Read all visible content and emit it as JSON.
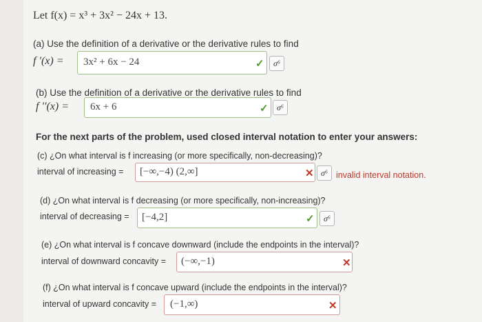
{
  "problem": {
    "statement": "Let f(x) = x³ + 3x² − 24x + 13."
  },
  "part_a": {
    "prompt": "(a)  Use the definition of a derivative or the derivative rules to find",
    "label": "f ′(x) =",
    "answer": "3x² + 6x − 24",
    "status": "correct",
    "check_icon": "check-icon",
    "symbol_button_label": "σ⁶"
  },
  "part_b": {
    "prompt": "(b)  Use the definition of a derivative or the derivative rules to find",
    "label": "f ′′(x) =",
    "answer": "6x + 6",
    "status": "correct",
    "symbol_button_label": "σ⁶"
  },
  "instructions": "For the next parts of the problem, used closed interval notation to enter your answers:",
  "part_c": {
    "prompt": "(c)  ¿On what interval is f increasing (or more specifically, non-decreasing)?",
    "label": "interval of increasing =",
    "answer": "[−∞,−4) (2,∞]",
    "status": "incorrect",
    "feedback": "invalid interval notation.",
    "symbol_button_label": "σ⁶"
  },
  "part_d": {
    "prompt": "(d)  ¿On what interval is f decreasing (or more specifically, non-increasing)?",
    "label": "interval of decreasing =",
    "answer": "[−4,2]",
    "status": "correct",
    "symbol_button_label": "σ⁶"
  },
  "part_e": {
    "prompt": "(e)  ¿On what interval is f concave downward (include the endpoints in the interval)?",
    "label": "interval of downward concavity =",
    "answer": "(−∞,−1)",
    "status": "incorrect"
  },
  "part_f": {
    "prompt": "(f)  ¿On what interval is f concave upward (include the endpoints in the interval)?",
    "label": "interval of upward concavity =",
    "answer": "(−1,∞)",
    "status": "incorrect"
  },
  "colors": {
    "correct": "#4f9a2a",
    "incorrect": "#c0392b",
    "background": "#f4f4f2"
  }
}
